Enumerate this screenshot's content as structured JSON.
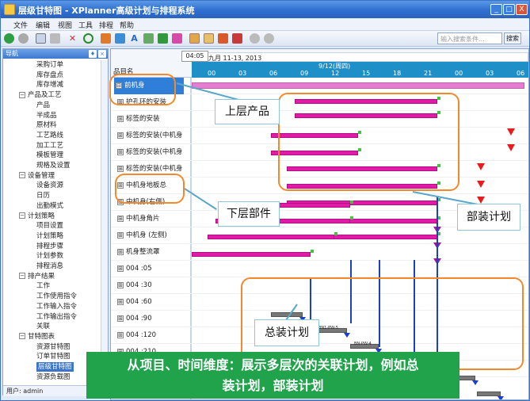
{
  "window": {
    "title": "层级甘特图 - XPlanner高级计划与排程系统",
    "min": "_",
    "max": "□",
    "close": "X"
  },
  "menu": [
    "文件",
    "编辑",
    "视图",
    "工具",
    "排程",
    "帮助"
  ],
  "toolbar": {
    "search_placeholder": "输入搜索条件...",
    "search_button": "搜索"
  },
  "nav": {
    "title": "导航",
    "items": [
      {
        "label": "采购订单",
        "level": 2
      },
      {
        "label": "库存盘点",
        "level": 2
      },
      {
        "label": "库存增减",
        "level": 2
      },
      {
        "label": "产品及工艺",
        "level": 1
      },
      {
        "label": "产品",
        "level": 2
      },
      {
        "label": "半成品",
        "level": 2
      },
      {
        "label": "原材料",
        "level": 2
      },
      {
        "label": "工艺路线",
        "level": 2
      },
      {
        "label": "加工工艺",
        "level": 2
      },
      {
        "label": "模板管理",
        "level": 2
      },
      {
        "label": "规格及设置",
        "level": 2
      },
      {
        "label": "设备管理",
        "level": 1
      },
      {
        "label": "设备资源",
        "level": 2
      },
      {
        "label": "日历",
        "level": 2
      },
      {
        "label": "出勤模式",
        "level": 2
      },
      {
        "label": "计划策略",
        "level": 1
      },
      {
        "label": "项目设置",
        "level": 2
      },
      {
        "label": "计划策略",
        "level": 2
      },
      {
        "label": "排程步骤",
        "level": 2
      },
      {
        "label": "计划参数",
        "level": 2
      },
      {
        "label": "排程消息",
        "level": 2
      },
      {
        "label": "排产结果",
        "level": 1
      },
      {
        "label": "工作",
        "level": 2
      },
      {
        "label": "工作使用指令",
        "level": 2
      },
      {
        "label": "工作输入指令",
        "level": 2
      },
      {
        "label": "工作输出指令",
        "level": 2
      },
      {
        "label": "关联",
        "level": 2
      },
      {
        "label": "甘特图表",
        "level": 1
      },
      {
        "label": "资源甘特图",
        "level": 2
      },
      {
        "label": "订单甘特图",
        "level": 2
      },
      {
        "label": "层级甘特图",
        "level": 2,
        "selected": true
      },
      {
        "label": "资源负载图",
        "level": 2
      }
    ],
    "status": "用户: admin"
  },
  "gantt": {
    "column_header": "品目名",
    "period": "九月 11-13, 2013",
    "day": "9/12(周四)",
    "hours": [
      "00",
      "03",
      "06",
      "09",
      "12",
      "15",
      "18",
      "21",
      "00",
      "03",
      "06"
    ],
    "tooltip_time": "04:05",
    "rows": [
      {
        "label": "前机身",
        "expander": "⊟",
        "selected": true
      },
      {
        "label": "护孔环的安装",
        "expander": "⊞"
      },
      {
        "label": "标签的安装",
        "expander": "⊞"
      },
      {
        "label": "标签的安装(中机身",
        "expander": "⊞"
      },
      {
        "label": "标签的安装(中机身",
        "expander": "⊞"
      },
      {
        "label": "标签的安装(中机身",
        "expander": "⊞"
      },
      {
        "label": "中机身地板总",
        "expander": "⊞"
      },
      {
        "label": "中机身(右侧)",
        "expander": "⊞"
      },
      {
        "label": "中机身角片",
        "expander": "⊞"
      },
      {
        "label": "中机身 (左侧)",
        "expander": "⊞"
      },
      {
        "label": "机身整流罩",
        "expander": "⊞"
      },
      {
        "label": "004 :05",
        "expander": "⊞"
      },
      {
        "label": "004 :30",
        "expander": "⊞"
      },
      {
        "label": "004 :60",
        "expander": "⊞"
      },
      {
        "label": "004 :90",
        "expander": "⊞"
      },
      {
        "label": "004 :120",
        "expander": "⊞"
      },
      {
        "label": "004 :210",
        "expander": "⊞"
      },
      {
        "label": "前机身",
        "expander": "⊞"
      }
    ],
    "bar_labels": [
      "BN1-PW-5",
      "BN-PW-4",
      "BN-1-前机"
    ]
  },
  "callouts": {
    "upper": "上层产品",
    "lower": "下层部件",
    "subassembly": "部装计划",
    "final": "总装计划"
  },
  "banner": {
    "line1": "从项目、时间维度：展示多层次的关联计划，例如总",
    "line2": "装计划，部装计划"
  },
  "colors": {
    "bar": "#e21aa8",
    "dependency": "#1a3fcc",
    "milestone": "#e81c1c",
    "banner": "#21a34c",
    "highlight": "#f28a2d"
  }
}
